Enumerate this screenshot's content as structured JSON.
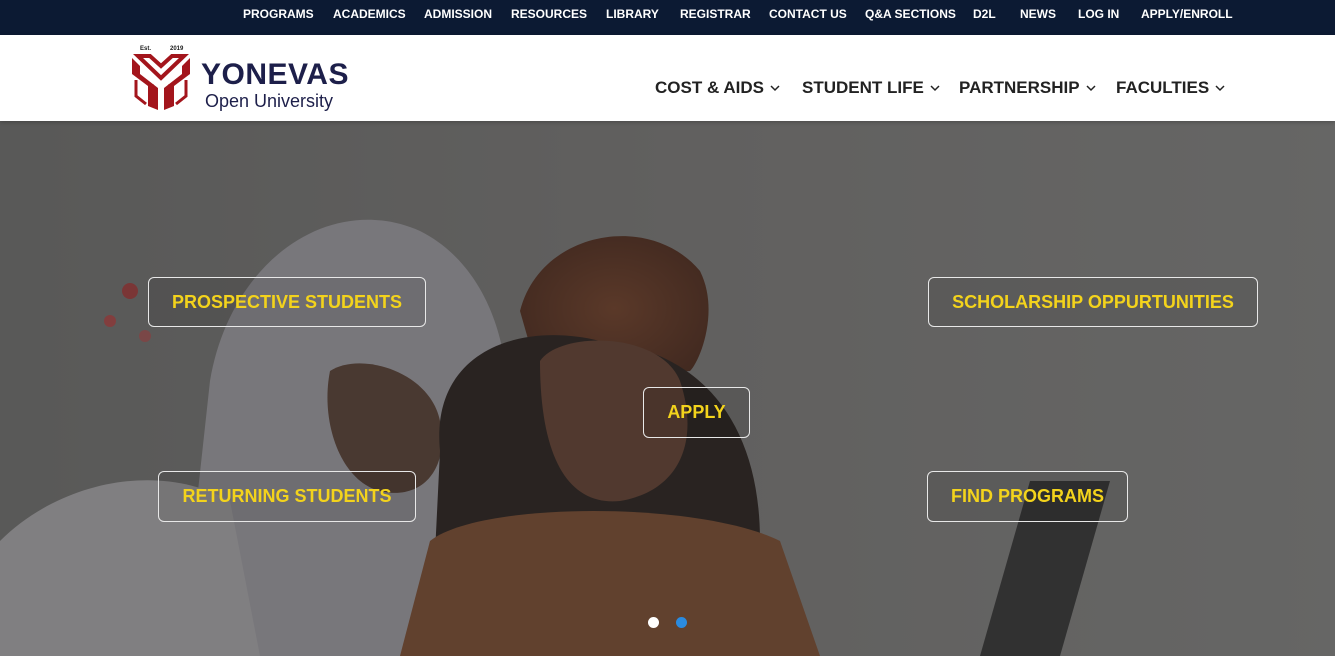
{
  "topnav": {
    "items": [
      "PROGRAMS",
      "ACADEMICS",
      "ADMISSION",
      "RESOURCES",
      "LIBRARY",
      "REGISTRAR",
      "CONTACT US",
      "Q&A SECTIONS",
      "D2L",
      "NEWS",
      "LOG IN",
      "APPLY/ENROLL"
    ]
  },
  "logo": {
    "est": "Est.",
    "year": "2019",
    "name": "YONEVAS",
    "subtitle": "Open University"
  },
  "mainnav": {
    "items": [
      "COST & AIDS",
      "STUDENT LIFE",
      "PARTNERSHIP",
      "FACULTIES"
    ]
  },
  "hero": {
    "prospective": "PROSPECTIVE STUDENTS",
    "scholarship": "SCHOLARSHIP OPPURTUNITIES",
    "apply": "APPLY",
    "returning": "RETURNING STUDENTS",
    "find_programs": "FIND PROGRAMS"
  },
  "colors": {
    "topbar": "#0c1a33",
    "cta_text": "#f3d31c",
    "logo_red": "#a3151c",
    "logo_navy": "#1d1f4a",
    "dot_active": "#ffffff",
    "dot_inactive": "#2a8be0"
  },
  "slider": {
    "slides": 2,
    "active": 1
  }
}
